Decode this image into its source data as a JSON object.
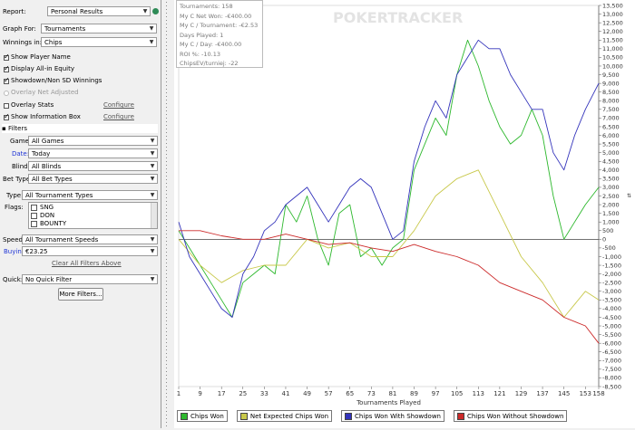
{
  "sidebar": {
    "report_label": "Report:",
    "report_value": "Personal Results",
    "graph_for_label": "Graph For:",
    "graph_for_value": "Tournaments",
    "winnings_in_label": "Winnings in:",
    "winnings_in_value": "Chips",
    "options": [
      {
        "label": "Show Player Name",
        "checked": true
      },
      {
        "label": "Display All-in Equity",
        "checked": true
      },
      {
        "label": "Showdown/Non SD Winnings",
        "checked": true
      },
      {
        "label": "Overlay Net Adjusted",
        "checked": false,
        "disabled": true
      },
      {
        "label": "Overlay Stats",
        "checked": false
      },
      {
        "label": "Show Information Box",
        "checked": true
      }
    ],
    "configure_label": "Configure",
    "filters_heading": "Filters",
    "game_label": "Game:",
    "game_value": "All Games",
    "date_label": "Date:",
    "date_value": "Today",
    "blind_label": "Blind:",
    "blind_value": "All Blinds",
    "bet_type_label": "Bet Type:",
    "bet_type_value": "All Bet Types",
    "type_label": "Type:",
    "type_value": "All Tournament Types",
    "flags_label": "Flags:",
    "flags": [
      "SNG",
      "DON",
      "BOUNTY"
    ],
    "speed_label": "Speed:",
    "speed_value": "All Tournament Speeds",
    "buyin_label": "Buyin:",
    "buyin_value": "€23.25",
    "clear_filters": "Clear All Filters Above",
    "quick_label": "Quick:",
    "quick_value": "No Quick Filter",
    "more_filters": "More Filters..."
  },
  "stats_box": {
    "lines": [
      "Tournaments: 158",
      "My C Net Won: -€400.00",
      "My C / Tournament: -€2.53",
      "Days Played: 1",
      "My C / Day: -€400.00",
      "ROI %: -10.13",
      "ChipsEV/turniej: -22"
    ]
  },
  "watermark": "POKERTRACKER",
  "colors": {
    "chips_won": "#2db82d",
    "net_expected": "#c8c84a",
    "with_showdown": "#3333bb",
    "without_showdown": "#cc2a2a"
  },
  "chart_data": {
    "type": "line",
    "xlabel": "Tournaments Played",
    "ylabel": "",
    "x_ticks": [
      1,
      9,
      17,
      25,
      33,
      41,
      49,
      57,
      65,
      73,
      81,
      89,
      97,
      105,
      113,
      121,
      129,
      137,
      145,
      153,
      158
    ],
    "y_ticks": [
      13500,
      13000,
      12500,
      12000,
      11500,
      11000,
      10500,
      10000,
      9500,
      9000,
      8500,
      8000,
      7500,
      7000,
      6500,
      6000,
      5500,
      5000,
      4500,
      4000,
      3500,
      3000,
      2500,
      2000,
      1500,
      1000,
      500,
      0,
      -500,
      -1000,
      -1500,
      -2000,
      -2500,
      -3000,
      -3500,
      -4000,
      -4500,
      -5000,
      -5500,
      -6000,
      -6500,
      -7000,
      -7500,
      -8000,
      -8500
    ],
    "ylim": [
      -8500,
      13500
    ],
    "xlim": [
      1,
      158
    ],
    "series": [
      {
        "name": "Chips Won",
        "x": [
          1,
          5,
          9,
          13,
          17,
          21,
          25,
          29,
          33,
          37,
          41,
          45,
          49,
          53,
          57,
          61,
          65,
          69,
          73,
          77,
          81,
          85,
          89,
          93,
          97,
          101,
          105,
          109,
          113,
          117,
          121,
          125,
          129,
          133,
          137,
          141,
          145,
          149,
          153,
          158
        ],
        "values": [
          500,
          -500,
          -1500,
          -2500,
          -3500,
          -4500,
          -2500,
          -2000,
          -1500,
          -2000,
          2000,
          1000,
          2500,
          0,
          -1500,
          1500,
          2000,
          -1000,
          -500,
          -1500,
          -500,
          0,
          4000,
          5500,
          7000,
          6000,
          9500,
          11500,
          10000,
          8000,
          6500,
          5500,
          6000,
          7500,
          6000,
          2500,
          0,
          1000,
          2000,
          3000
        ]
      },
      {
        "name": "Net Expected Chips Won",
        "x": [
          1,
          9,
          17,
          25,
          33,
          41,
          49,
          57,
          65,
          73,
          81,
          89,
          97,
          105,
          113,
          121,
          129,
          137,
          145,
          153,
          158
        ],
        "values": [
          0,
          -1500,
          -2500,
          -1800,
          -1500,
          -1500,
          0,
          -500,
          -200,
          -1000,
          -1000,
          500,
          2500,
          3500,
          4000,
          1500,
          -1000,
          -2500,
          -4500,
          -3000,
          -3500
        ]
      },
      {
        "name": "Chips Won With Showdown",
        "x": [
          1,
          5,
          9,
          13,
          17,
          21,
          25,
          29,
          33,
          37,
          41,
          45,
          49,
          53,
          57,
          61,
          65,
          69,
          73,
          77,
          81,
          85,
          89,
          93,
          97,
          101,
          105,
          109,
          113,
          117,
          121,
          125,
          129,
          133,
          137,
          141,
          145,
          149,
          153,
          158
        ],
        "values": [
          1000,
          -1000,
          -2000,
          -3000,
          -4000,
          -4500,
          -2000,
          -1000,
          500,
          1000,
          2000,
          2500,
          3000,
          2000,
          1000,
          2000,
          3000,
          3500,
          3000,
          1500,
          0,
          500,
          4500,
          6500,
          8000,
          7000,
          9500,
          10500,
          11500,
          11000,
          11000,
          9500,
          8500,
          7500,
          7500,
          5000,
          4000,
          6000,
          7500,
          9000
        ]
      },
      {
        "name": "Chips Won Without Showdown",
        "x": [
          1,
          9,
          17,
          25,
          33,
          41,
          49,
          57,
          65,
          73,
          81,
          89,
          97,
          105,
          113,
          121,
          129,
          137,
          145,
          153,
          158
        ],
        "values": [
          500,
          500,
          200,
          0,
          0,
          300,
          0,
          -300,
          -200,
          -500,
          -700,
          -300,
          -700,
          -1000,
          -1500,
          -2500,
          -3000,
          -3500,
          -4500,
          -5000,
          -6000
        ]
      }
    ]
  }
}
